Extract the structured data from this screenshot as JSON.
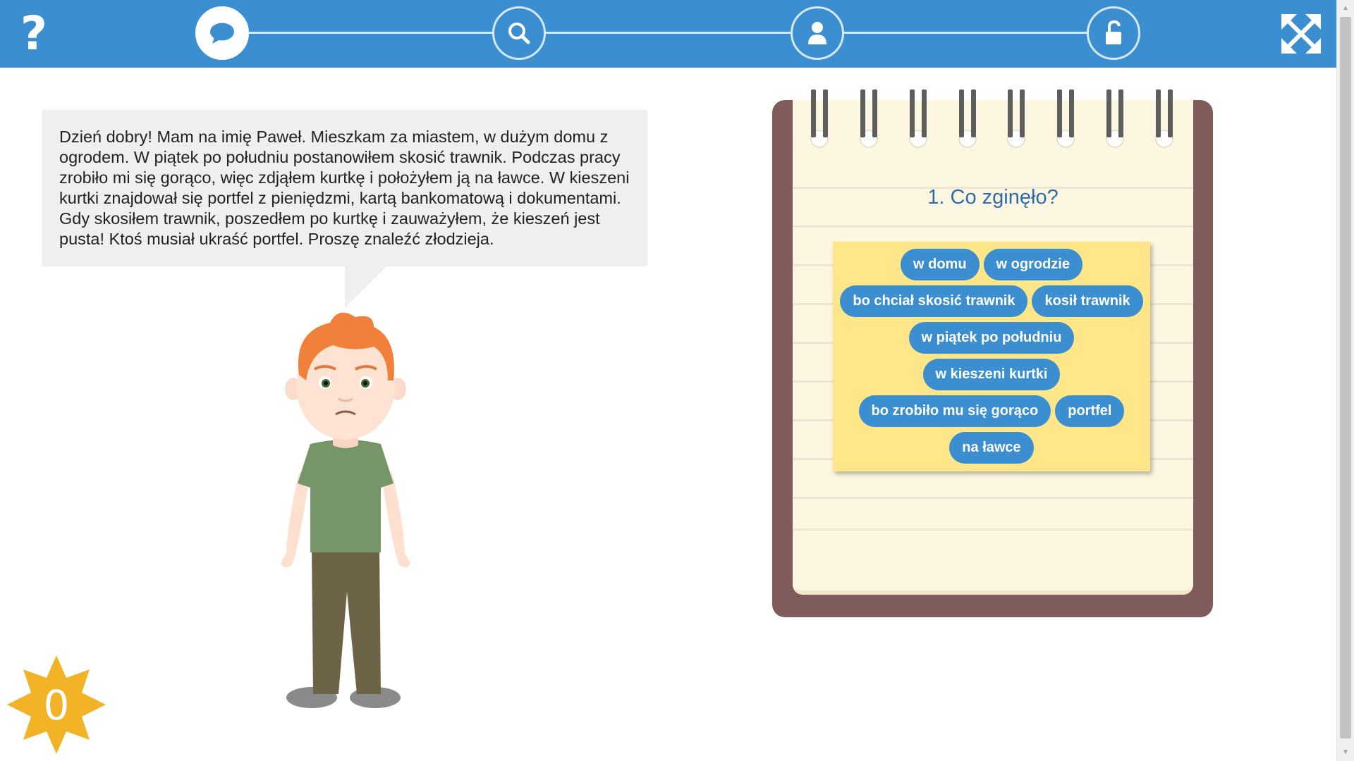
{
  "header": {
    "help_symbol": "?",
    "steps": [
      {
        "icon": "speech-bubble-icon",
        "active": true
      },
      {
        "icon": "magnifier-icon",
        "active": false
      },
      {
        "icon": "person-icon",
        "active": false
      },
      {
        "icon": "unlocked-padlock-icon",
        "active": false
      }
    ],
    "fullscreen_icon": "expand-arrows-icon"
  },
  "story": {
    "text": "Dzień dobry! Mam na imię Paweł. Mieszkam za miastem, w dużym domu z ogrodem. W piątek po południu postanowiłem skosić trawnik. Podczas pracy zrobiło mi się gorąco, więc zdjąłem kurtkę i położyłem ją na ławce. W kieszeni kurtki znajdował się portfel z pieniędzmi, kartą bankomatową i dokumentami. Gdy skosiłem trawnik, poszedłem po kurtkę i zauważyłem, że kieszeń jest pusta! Ktoś musiał ukraść portfel. Proszę znaleźć złodzieja."
  },
  "notebook": {
    "question": "1. Co zginęło?",
    "answers": [
      "w domu",
      "w ogrodzie",
      "bo chciał skosić trawnik",
      "kosił trawnik",
      "w piątek po południu",
      "w kieszeni kurtki",
      "bo zrobiło mu się gorąco",
      "portfel",
      "na ławce"
    ]
  },
  "score": {
    "value": "0"
  },
  "colors": {
    "primary_blue": "#3b8fd0",
    "notebook_brown": "#7f5b59",
    "card_yellow": "#fee689",
    "score_orange": "#f2b426"
  }
}
